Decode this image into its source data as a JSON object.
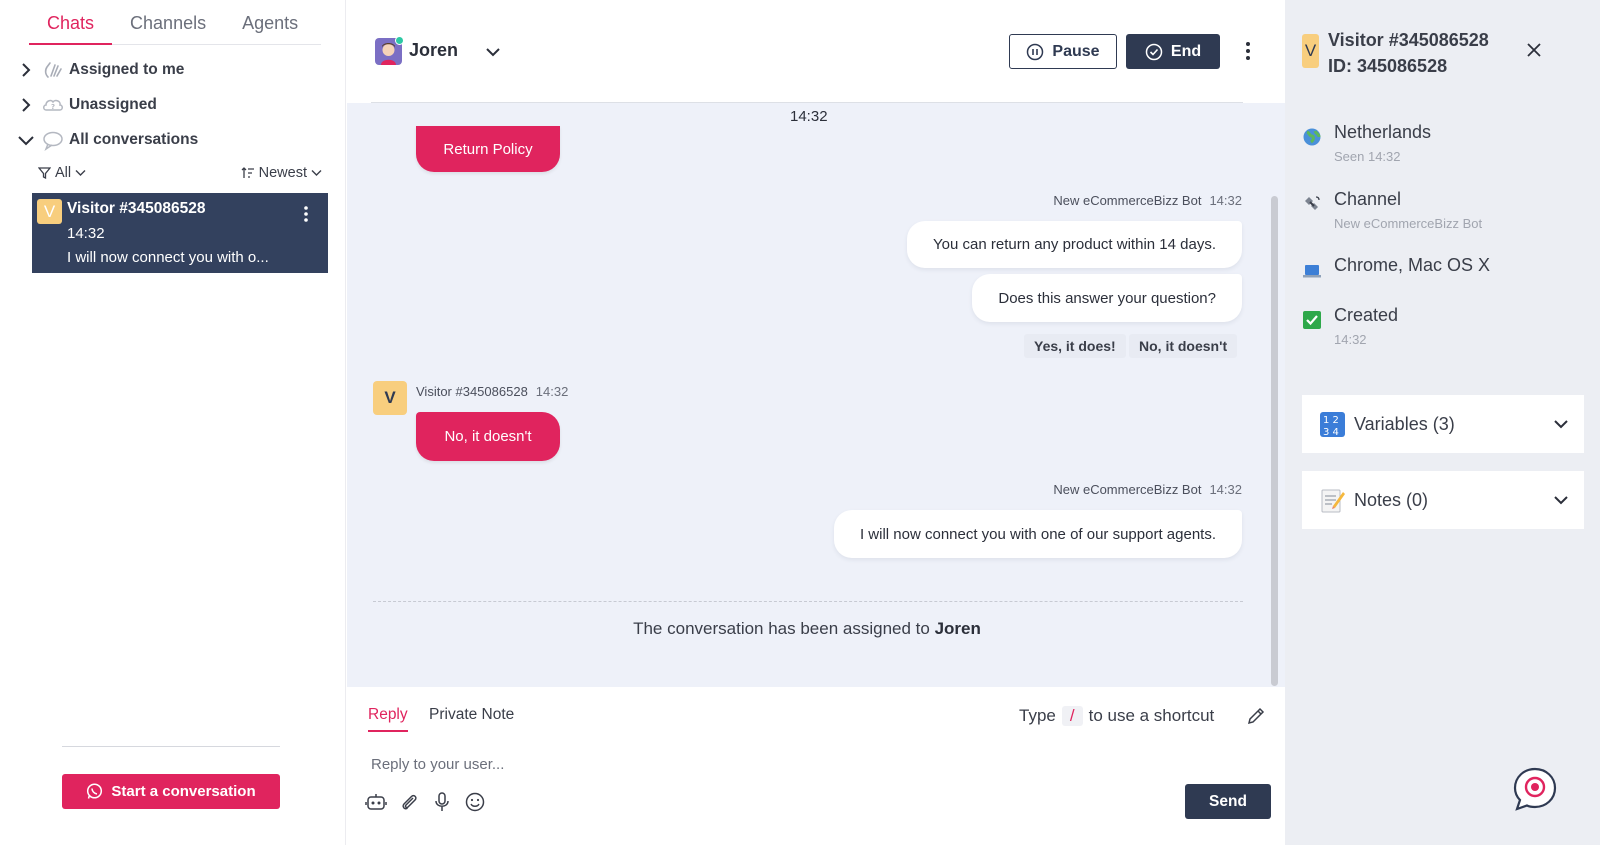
{
  "left": {
    "tabs": [
      "Chats",
      "Channels",
      "Agents"
    ],
    "tree": {
      "assigned": "Assigned to me",
      "unassigned": "Unassigned",
      "all": "All conversations"
    },
    "filter": {
      "all": "All",
      "sort": "Newest"
    },
    "conversation": {
      "avatar": "V",
      "name": "Visitor #345086528",
      "time": "14:32",
      "preview": "I will now connect you with o..."
    },
    "start_button": "Start a conversation"
  },
  "main": {
    "agent": {
      "name": "Joren"
    },
    "pause_label": "Pause",
    "end_label": "End",
    "chat": {
      "time_divider": "14:32",
      "pill_return_policy": "Return Policy",
      "bot_meta_1": {
        "sender": "New eCommerceBizz Bot",
        "time": "14:32"
      },
      "bot_msg_1": "You can return any product within 14 days.",
      "bot_msg_2": "Does this answer your question?",
      "quick_replies": [
        "Yes, it does!",
        "No, it doesn't"
      ],
      "visitor_avatar": "V",
      "visitor_meta": {
        "sender": "Visitor #345086528",
        "time": "14:32"
      },
      "visitor_msg": "No, it doesn't",
      "bot_meta_2": {
        "sender": "New eCommerceBizz Bot",
        "time": "14:32"
      },
      "bot_msg_3": "I will now connect you with one of our support agents.",
      "assigned_text": "The conversation has been assigned to",
      "assigned_agent": "Joren"
    },
    "composer": {
      "tab_reply": "Reply",
      "tab_note": "Private Note",
      "hint_pre": "Type",
      "hint_key": "/",
      "hint_post": "to use a shortcut",
      "placeholder": "Reply to your user...",
      "send_label": "Send"
    }
  },
  "right": {
    "avatar": "V",
    "title": "Visitor #345086528",
    "id_line": "ID: 345086528",
    "info": {
      "country": "Netherlands",
      "country_sub": "Seen 14:32",
      "channel": "Channel",
      "channel_sub": "New eCommerceBizz Bot",
      "browser": "Chrome, Mac OS X",
      "created": "Created",
      "created_sub": "14:32"
    },
    "variables_label": "Variables (3)",
    "notes_label": "Notes (0)"
  },
  "colors": {
    "accent": "#e0245e",
    "navy": "#2f3a52",
    "chat_bg": "#eef1f9",
    "panel_bg": "#eceef3",
    "visitor_avatar": "#f8ce7e"
  }
}
